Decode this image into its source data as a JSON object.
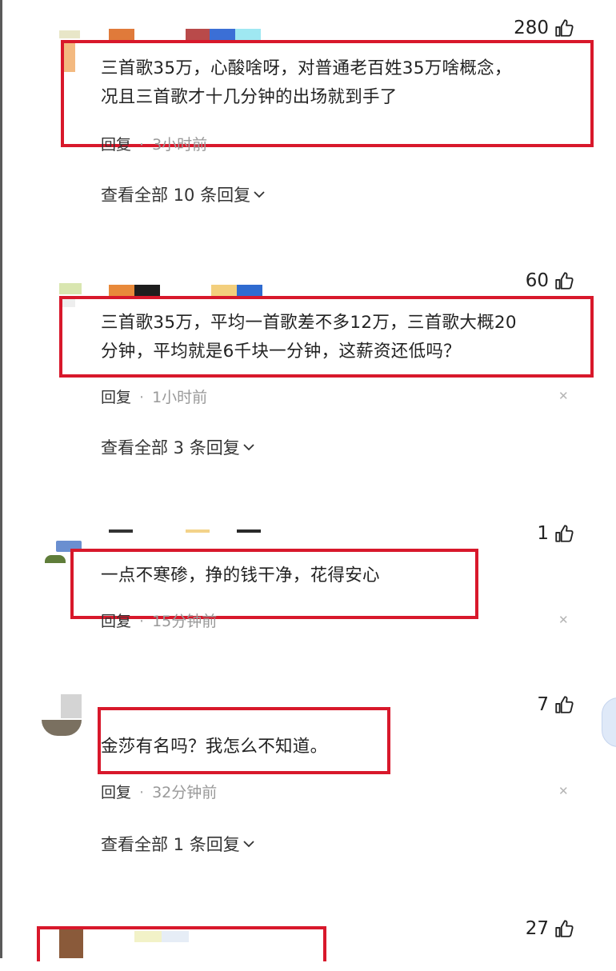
{
  "comments": [
    {
      "likes": "280",
      "text_lines": [
        "三首歌35万，心酸啥呀，对普通老百姓35万啥概念，",
        "况且三首歌才十几分钟的出场就到手了"
      ],
      "reply_label": "回复",
      "time": "3小时前",
      "view_all": "查看全部 10 条回复"
    },
    {
      "likes": "60",
      "text_lines": [
        "三首歌35万，平均一首歌差不多12万，三首歌大概20",
        "分钟，平均就是6千块一分钟，这薪资还低吗？"
      ],
      "reply_label": "回复",
      "time": "1小时前",
      "view_all": "查看全部 3 条回复"
    },
    {
      "likes": "1",
      "text_lines": [
        "一点不寒碜，挣的钱干净，花得安心"
      ],
      "reply_label": "回复",
      "time": "15分钟前"
    },
    {
      "likes": "7",
      "text_lines": [
        "金莎有名吗？我怎么不知道。"
      ],
      "reply_label": "回复",
      "time": "32分钟前",
      "view_all": "查看全部 1 条回复"
    },
    {
      "likes": "27"
    }
  ],
  "icons": {
    "like": "thumbs-up-icon",
    "close": "close-icon",
    "expand": "chevron-down-icon"
  },
  "colors": {
    "highlight_box": "#d8182b",
    "text": "#222222",
    "muted": "#999999"
  }
}
